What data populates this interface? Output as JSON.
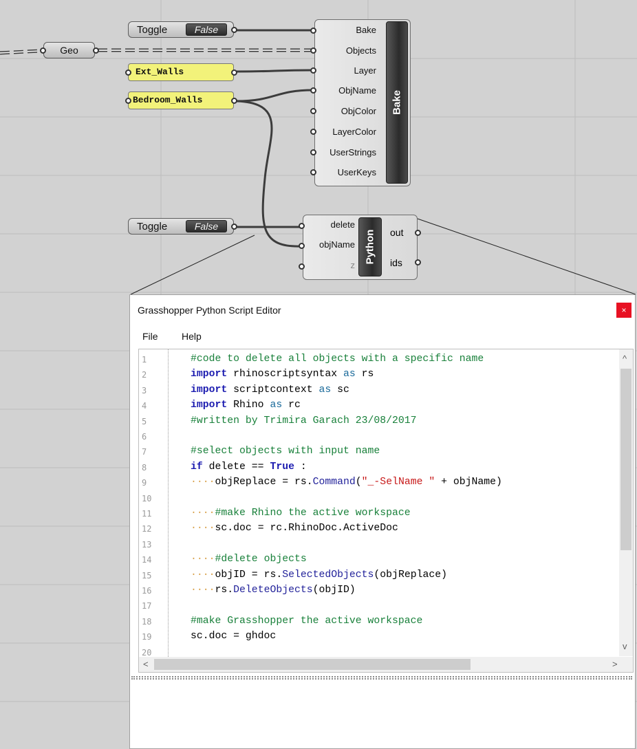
{
  "canvas": {
    "geo_label": "Geo",
    "toggle1": {
      "label": "Toggle",
      "value": "False"
    },
    "toggle2": {
      "label": "Toggle",
      "value": "False"
    },
    "panel_ext": "Ext_Walls",
    "panel_bedroom": "Bedroom_Walls",
    "bake": {
      "name": "Bake",
      "inputs": [
        "Bake",
        "Objects",
        "Layer",
        "ObjName",
        "ObjColor",
        "LayerColor",
        "UserStrings",
        "UserKeys"
      ]
    },
    "python": {
      "name": "Python",
      "inputs": [
        "delete",
        "objName",
        "z"
      ],
      "outputs": [
        "out",
        "ids"
      ]
    }
  },
  "editor": {
    "title": "Grasshopper Python Script Editor",
    "close": "×",
    "menu": [
      "File",
      "Help"
    ],
    "line_numbers": [
      "1",
      "2",
      "3",
      "4",
      "5",
      "6",
      "7",
      "8",
      "9",
      "10",
      "11",
      "12",
      "13",
      "14",
      "15",
      "16",
      "17",
      "18",
      "19",
      "20"
    ],
    "code": {
      "l1": "#code to delete all objects with a specific name",
      "l2_kw": "import",
      "l2_rest": " rhinoscriptsyntax ",
      "l2_as": "as",
      "l2_end": " rs",
      "l3_kw": "import",
      "l3_rest": " scriptcontext ",
      "l3_as": "as",
      "l3_end": " sc",
      "l4_kw": "import",
      "l4_rest": " Rhino ",
      "l4_as": "as",
      "l4_end": " rc",
      "l5": "#written by Trimira Garach 23/08/2017",
      "l7": "#select objects with input name",
      "l8_kw": "if",
      "l8_rest": " delete == ",
      "l8_true": "True",
      "l8_end": " :",
      "l9_a": "objReplace = rs.",
      "l9_fn": "Command",
      "l9_b": "(",
      "l9_str": "\"_-SelName \"",
      "l9_c": " + objName)",
      "l11": "#make Rhino the active workspace",
      "l12": "sc.doc = rc.RhinoDoc.ActiveDoc",
      "l14": "#delete objects",
      "l15_a": "objID = rs.",
      "l15_fn": "SelectedObjects",
      "l15_b": "(objReplace)",
      "l16_a": "rs.",
      "l16_fn": "DeleteObjects",
      "l16_b": "(objID)",
      "l18": "#make Grasshopper the active workspace",
      "l19": "sc.doc = ghdoc",
      "indent": "····"
    },
    "scroll_up": "^",
    "scroll_down": "v",
    "scroll_left": "<",
    "scroll_right": ">"
  },
  "colors": {
    "canvas_bg": "#d2d2d2",
    "grid_line": "#b9b9b9",
    "comment": "#18803a",
    "keyword": "#1c1cb0",
    "string": "#c71818",
    "close_button": "#e81123"
  }
}
